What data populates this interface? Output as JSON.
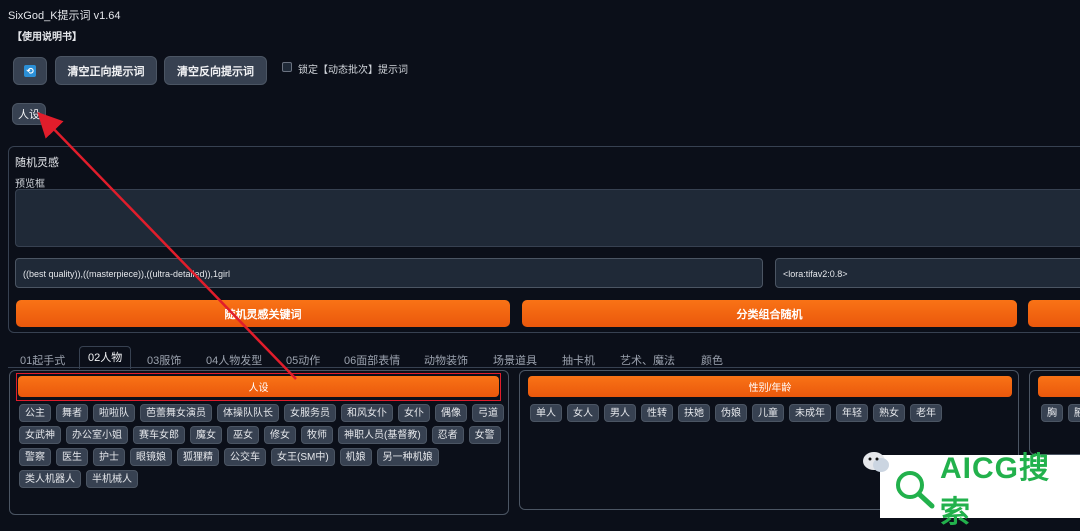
{
  "app": {
    "title": "SixGod_K提示词 v1.64",
    "manual": "【使用说明书】"
  },
  "toolbar": {
    "refresh_icon": "refresh-icon",
    "clear_positive": "清空正向提示词",
    "clear_negative": "清空反向提示词",
    "lock_label": "锁定【动态批次】提示词"
  },
  "persona_button": "人设",
  "random": {
    "section_label": "随机灵感",
    "preview_label": "预览框",
    "positive_value": "((best quality)),((masterpiece)),((ultra-detailed)),1girl",
    "lora_value": "<lora:tifav2:0.8>",
    "btn_keywords": "随机灵感关键词",
    "btn_category": "分类组合随机"
  },
  "tabs": [
    "01起手式",
    "02人物",
    "03服饰",
    "04人物发型",
    "05动作",
    "06面部表情",
    "动物装饰",
    "场景道具",
    "抽卡机",
    "艺术、魔法",
    "颜色"
  ],
  "panels": {
    "persona": {
      "header": "人设",
      "chips": [
        "公主",
        "舞者",
        "啦啦队",
        "芭蕾舞女演员",
        "体操队队长",
        "女服务员",
        "和风女仆",
        "女仆",
        "偶像",
        "弓道",
        "女武神",
        "办公室小姐",
        "赛车女郎",
        "魔女",
        "巫女",
        "修女",
        "牧师",
        "神职人员(基督教)",
        "忍者",
        "女警",
        "警察",
        "医生",
        "护士",
        "眼镜娘",
        "狐狸精",
        "公交车",
        "女王(SM中)",
        "机娘",
        "另一种机娘",
        "类人机器人",
        "半机械人"
      ]
    },
    "gender": {
      "header": "性别/年龄",
      "chips": [
        "单人",
        "女人",
        "男人",
        "性转",
        "扶她",
        "伪娘",
        "儿童",
        "未成年",
        "年轻",
        "熟女",
        "老年"
      ]
    },
    "body": {
      "chips": [
        "胸",
        "腋"
      ]
    }
  },
  "watermark": {
    "text": "AICG搜索",
    "icon": "wechat-icon"
  },
  "colors": {
    "accent": "#f97316",
    "annotation": "#e11d2b",
    "bg": "#0b0f19"
  }
}
